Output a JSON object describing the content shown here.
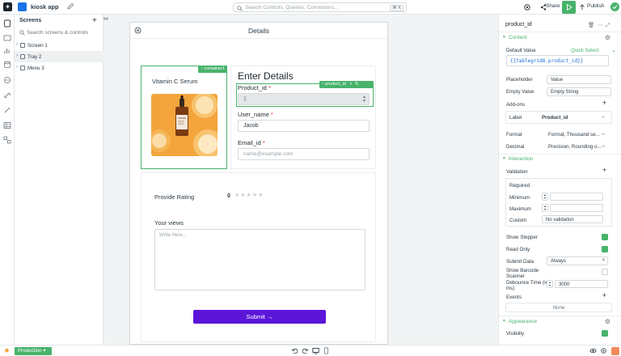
{
  "app": {
    "name": "kiosk app"
  },
  "topbar": {
    "search_placeholder": "Search Controls, Queries, Connectors...",
    "search_shortcut": "⌘ K",
    "share_label": "Share",
    "publish_label": "Publish"
  },
  "screens_panel": {
    "title": "Screens",
    "search_placeholder": "Search screens & controls",
    "items": [
      {
        "label": "Screen 1"
      },
      {
        "label": "Tray 2"
      },
      {
        "label": "Menu 3"
      }
    ]
  },
  "canvas": {
    "title": "Details",
    "container_tag": "container1",
    "product_card_title": "Vitamin C Serum",
    "form_title": "Enter Details",
    "product_id_label": "Product_id",
    "product_id_value": "1",
    "product_id_tag": "product_id",
    "user_name_label": "User_name",
    "user_name_value": "Jacob",
    "email_label": "Email_id",
    "email_placeholder": "name@example.com",
    "required_mark": "*",
    "rating_label": "Provide Rating",
    "rating_value": "0",
    "views_label": "Your views",
    "views_placeholder": "Write Here...",
    "submit_label": "Submit"
  },
  "inspector": {
    "title": "product_id",
    "content_section": "Content",
    "default_value_label": "Default Value",
    "quick_select": "Quick Select",
    "default_value_code": "{{tablegrid8.product_id}}",
    "placeholder_label": "Placeholder",
    "placeholder_value": "Value",
    "empty_value_label": "Empty Value",
    "empty_value_value": "Empty String",
    "addons_label": "Add-ons",
    "addon_label_key": "Label",
    "addon_label_value": "Product_id",
    "format_label": "Format",
    "format_value": "Format, Thousand se...",
    "decimal_label": "Decimal",
    "decimal_value": "Precision, Rounding o...",
    "interaction_section": "Interaction",
    "validation_label": "Validation",
    "required_label": "Required",
    "minimum_label": "Minimum",
    "maximum_label": "Maximum",
    "custom_label": "Custom",
    "custom_value": "No validation",
    "show_stepper_label": "Show Stepper",
    "read_only_label": "Read Only",
    "submit_data_label": "Submit Data",
    "submit_data_value": "Always",
    "barcode_label": "Show Barcode Scanner",
    "debounce_label": "Debounce Time (in ms)",
    "debounce_value": "3000",
    "events_label": "Events",
    "events_value": "None",
    "appearance_section": "Appearance",
    "visibility_label": "Visibility"
  },
  "bottombar": {
    "environment": "Production"
  },
  "colors": {
    "accent": "#47b36b",
    "primary": "#5b16d9",
    "link": "#1a6cd1"
  }
}
